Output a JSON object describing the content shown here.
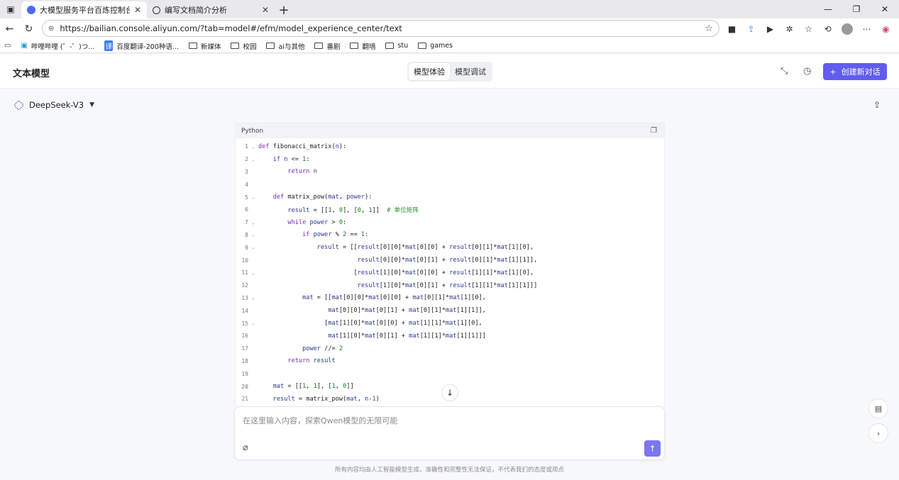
{
  "browser": {
    "tabs": [
      {
        "title": "大模型服务平台百炼控制台",
        "active": true,
        "favicon_color": "#4b6bf5"
      },
      {
        "title": "编写文档简介分析",
        "active": false,
        "favicon_color": "#333333"
      }
    ],
    "url": "https://bailian.console.aliyun.com/?tab=model#/efm/model_experience_center/text",
    "bookmarks": [
      {
        "label": "哔哩哔哩 (゜-゜)つ...",
        "icon": "bilibili-icon"
      },
      {
        "label": "百度翻译-200种语...",
        "icon": "translate-icon"
      },
      {
        "label": "新媒体",
        "icon": "folder-icon"
      },
      {
        "label": "校园",
        "icon": "folder-icon"
      },
      {
        "label": "ai与其他",
        "icon": "folder-icon"
      },
      {
        "label": "番剧",
        "icon": "folder-icon"
      },
      {
        "label": "翻墙",
        "icon": "folder-icon"
      },
      {
        "label": "stu",
        "icon": "folder-icon"
      },
      {
        "label": "games",
        "icon": "folder-icon"
      }
    ]
  },
  "app": {
    "title": "文本模型",
    "segments": [
      "模型体验",
      "模型调试"
    ],
    "active_segment": "模型体验",
    "new_chat_label": "创建新对话",
    "accent": "#615ced",
    "model": "DeepSeek-V3"
  },
  "code": {
    "language": "Python",
    "lines": [
      {
        "n": "1",
        "fold": true,
        "tokens": [
          [
            "kw",
            "def "
          ],
          [
            "fn",
            "fibonacci_matrix("
          ],
          [
            "src",
            "n"
          ],
          [
            "fn",
            "):"
          ]
        ]
      },
      {
        "n": "2",
        "fold": true,
        "tokens": [
          [
            "fn",
            "    "
          ],
          [
            "kw",
            "if "
          ],
          [
            "src",
            "n "
          ],
          [
            "fn",
            "<= "
          ],
          [
            "num",
            "1"
          ],
          [
            "fn",
            ":"
          ]
        ]
      },
      {
        "n": "3",
        "fold": false,
        "tokens": [
          [
            "fn",
            "        "
          ],
          [
            "kw",
            "return "
          ],
          [
            "src",
            "n"
          ]
        ]
      },
      {
        "n": "4",
        "fold": false,
        "tokens": []
      },
      {
        "n": "5",
        "fold": true,
        "tokens": [
          [
            "fn",
            "    "
          ],
          [
            "kw",
            "def "
          ],
          [
            "fn",
            "matrix_pow("
          ],
          [
            "src",
            "mat"
          ],
          [
            "fn",
            ", "
          ],
          [
            "src",
            "power"
          ],
          [
            "fn",
            "):"
          ]
        ]
      },
      {
        "n": "6",
        "fold": false,
        "tokens": [
          [
            "fn",
            "        "
          ],
          [
            "src",
            "result "
          ],
          [
            "fn",
            "= [["
          ],
          [
            "num",
            "1"
          ],
          [
            "fn",
            ", "
          ],
          [
            "num",
            "0"
          ],
          [
            "fn",
            "], ["
          ],
          [
            "num",
            "0"
          ],
          [
            "fn",
            ", "
          ],
          [
            "num",
            "1"
          ],
          [
            "fn",
            "]]  "
          ],
          [
            "cm",
            "# 单位矩阵"
          ]
        ]
      },
      {
        "n": "7",
        "fold": true,
        "tokens": [
          [
            "fn",
            "        "
          ],
          [
            "kw",
            "while "
          ],
          [
            "src",
            "power "
          ],
          [
            "fn",
            "> "
          ],
          [
            "num",
            "0"
          ],
          [
            "fn",
            ":"
          ]
        ]
      },
      {
        "n": "8",
        "fold": true,
        "tokens": [
          [
            "fn",
            "            "
          ],
          [
            "kw",
            "if "
          ],
          [
            "src",
            "power "
          ],
          [
            "fn",
            "% "
          ],
          [
            "num",
            "2 "
          ],
          [
            "fn",
            "== "
          ],
          [
            "num",
            "1"
          ],
          [
            "fn",
            ":"
          ]
        ]
      },
      {
        "n": "9",
        "fold": true,
        "tokens": [
          [
            "fn",
            "                "
          ],
          [
            "src",
            "result "
          ],
          [
            "fn",
            "= [["
          ],
          [
            "src",
            "result"
          ],
          [
            "fn",
            "[0][0]*"
          ],
          [
            "src",
            "mat"
          ],
          [
            "fn",
            "[0][0] + "
          ],
          [
            "src",
            "result"
          ],
          [
            "fn",
            "[0][1]*"
          ],
          [
            "src",
            "mat"
          ],
          [
            "fn",
            "[1][0],"
          ]
        ]
      },
      {
        "n": "10",
        "fold": false,
        "tokens": [
          [
            "fn",
            "                           "
          ],
          [
            "src",
            "result"
          ],
          [
            "fn",
            "[0][0]*"
          ],
          [
            "src",
            "mat"
          ],
          [
            "fn",
            "[0][1] + "
          ],
          [
            "src",
            "result"
          ],
          [
            "fn",
            "[0][1]*"
          ],
          [
            "src",
            "mat"
          ],
          [
            "fn",
            "[1][1]],"
          ]
        ]
      },
      {
        "n": "11",
        "fold": true,
        "tokens": [
          [
            "fn",
            "                          ["
          ],
          [
            "src",
            "result"
          ],
          [
            "fn",
            "[1][0]*"
          ],
          [
            "src",
            "mat"
          ],
          [
            "fn",
            "[0][0] + "
          ],
          [
            "src",
            "result"
          ],
          [
            "fn",
            "[1][1]*"
          ],
          [
            "src",
            "mat"
          ],
          [
            "fn",
            "[1][0],"
          ]
        ]
      },
      {
        "n": "12",
        "fold": false,
        "tokens": [
          [
            "fn",
            "                           "
          ],
          [
            "src",
            "result"
          ],
          [
            "fn",
            "[1][0]*"
          ],
          [
            "src",
            "mat"
          ],
          [
            "fn",
            "[0][1] + "
          ],
          [
            "src",
            "result"
          ],
          [
            "fn",
            "[1][1]*"
          ],
          [
            "src",
            "mat"
          ],
          [
            "fn",
            "[1][1]]]"
          ]
        ]
      },
      {
        "n": "13",
        "fold": true,
        "tokens": [
          [
            "fn",
            "            "
          ],
          [
            "src",
            "mat "
          ],
          [
            "fn",
            "= [["
          ],
          [
            "src",
            "mat"
          ],
          [
            "fn",
            "[0][0]*"
          ],
          [
            "src",
            "mat"
          ],
          [
            "fn",
            "[0][0] + "
          ],
          [
            "src",
            "mat"
          ],
          [
            "fn",
            "[0][1]*"
          ],
          [
            "src",
            "mat"
          ],
          [
            "fn",
            "[1][0],"
          ]
        ]
      },
      {
        "n": "14",
        "fold": false,
        "tokens": [
          [
            "fn",
            "                   "
          ],
          [
            "src",
            "mat"
          ],
          [
            "fn",
            "[0][0]*"
          ],
          [
            "src",
            "mat"
          ],
          [
            "fn",
            "[0][1] + "
          ],
          [
            "src",
            "mat"
          ],
          [
            "fn",
            "[0][1]*"
          ],
          [
            "src",
            "mat"
          ],
          [
            "fn",
            "[1][1]],"
          ]
        ]
      },
      {
        "n": "15",
        "fold": true,
        "tokens": [
          [
            "fn",
            "                  ["
          ],
          [
            "src",
            "mat"
          ],
          [
            "fn",
            "[1][0]*"
          ],
          [
            "src",
            "mat"
          ],
          [
            "fn",
            "[0][0] + "
          ],
          [
            "src",
            "mat"
          ],
          [
            "fn",
            "[1][1]*"
          ],
          [
            "src",
            "mat"
          ],
          [
            "fn",
            "[1][0],"
          ]
        ]
      },
      {
        "n": "16",
        "fold": false,
        "tokens": [
          [
            "fn",
            "                   "
          ],
          [
            "src",
            "mat"
          ],
          [
            "fn",
            "[1][0]*"
          ],
          [
            "src",
            "mat"
          ],
          [
            "fn",
            "[0][1] + "
          ],
          [
            "src",
            "mat"
          ],
          [
            "fn",
            "[1][1]*"
          ],
          [
            "src",
            "mat"
          ],
          [
            "fn",
            "[1][1]]]"
          ]
        ]
      },
      {
        "n": "17",
        "fold": false,
        "tokens": [
          [
            "fn",
            "            "
          ],
          [
            "src",
            "power "
          ],
          [
            "fn",
            "//= "
          ],
          [
            "num",
            "2"
          ]
        ]
      },
      {
        "n": "18",
        "fold": false,
        "tokens": [
          [
            "fn",
            "        "
          ],
          [
            "kw",
            "return "
          ],
          [
            "src",
            "result"
          ]
        ]
      },
      {
        "n": "19",
        "fold": false,
        "tokens": []
      },
      {
        "n": "20",
        "fold": false,
        "tokens": [
          [
            "fn",
            "    "
          ],
          [
            "src",
            "mat "
          ],
          [
            "fn",
            "= [["
          ],
          [
            "num",
            "1"
          ],
          [
            "fn",
            ", "
          ],
          [
            "num",
            "1"
          ],
          [
            "fn",
            "], ["
          ],
          [
            "num",
            "1"
          ],
          [
            "fn",
            ", "
          ],
          [
            "num",
            "0"
          ],
          [
            "fn",
            "]]"
          ]
        ]
      },
      {
        "n": "21",
        "fold": false,
        "tokens": [
          [
            "fn",
            "    "
          ],
          [
            "src",
            "result "
          ],
          [
            "fn",
            "= matrix_pow("
          ],
          [
            "src",
            "mat"
          ],
          [
            "fn",
            ", "
          ],
          [
            "src",
            "n"
          ],
          [
            "fn",
            "-"
          ],
          [
            "num",
            "1"
          ],
          [
            "fn",
            ")"
          ]
        ]
      }
    ]
  },
  "input": {
    "placeholder": "在这里输入内容，探索Qwen模型的无限可能"
  },
  "disclaimer": "所有内容均由人工智能模型生成，准确性和完整性无法保证，不代表我们的态度或观点"
}
